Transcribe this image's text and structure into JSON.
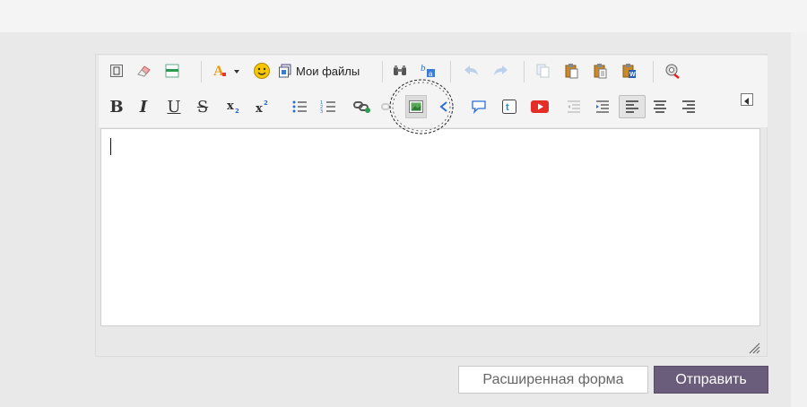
{
  "toolbar": {
    "my_files_label": "Мои файлы",
    "bold_label": "B",
    "italic_label": "I",
    "underline_label": "U",
    "strike_label": "S"
  },
  "buttons": {
    "advanced_form": "Расширенная форма",
    "submit": "Отправить"
  },
  "colors": {
    "submit_bg": "#6a5d7b",
    "accent_orange": "#f0a020",
    "youtube_red": "#e52d27"
  }
}
